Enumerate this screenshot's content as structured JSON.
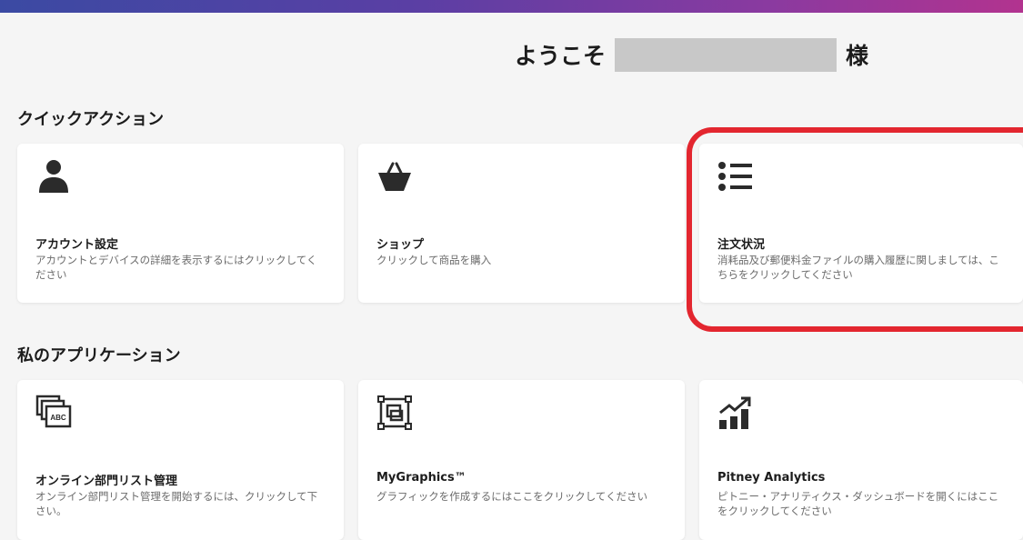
{
  "header": {
    "welcome_prefix": "ようこそ",
    "welcome_suffix": "様"
  },
  "quick_actions": {
    "title": "クイックアクション",
    "cards": [
      {
        "icon": "person-icon",
        "title": "アカウント設定",
        "description": "アカウントとデバイスの詳細を表示するにはクリックしてください"
      },
      {
        "icon": "basket-icon",
        "title": "ショップ",
        "description": "クリックして商品を購入"
      },
      {
        "icon": "list-icon",
        "title": "注文状況",
        "description": "消耗品及び郵便料金ファイルの購入履歴に関しましては、こちらをクリックしてください"
      }
    ]
  },
  "my_applications": {
    "title": "私のアプリケーション",
    "cards": [
      {
        "icon": "abc-cards-icon",
        "title": "オンライン部門リスト管理",
        "description": "オンライン部門リスト管理を開始するには、クリックして下さい。"
      },
      {
        "icon": "graphics-frame-icon",
        "title": "MyGraphics™",
        "description": "グラフィックを作成するにはここをクリックしてください"
      },
      {
        "icon": "analytics-chart-icon",
        "title": "Pitney Analytics",
        "description": "ピトニー・アナリティクス・ダッシュボードを開くにはここをクリックしてください"
      }
    ]
  },
  "colors": {
    "highlight": "#e3262f",
    "icon": "#2b2b2b"
  }
}
